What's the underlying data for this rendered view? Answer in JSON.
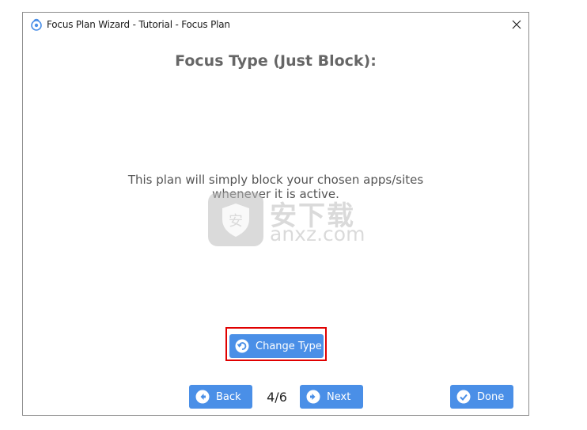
{
  "window": {
    "title": "Focus Plan Wizard - Tutorial - Focus Plan"
  },
  "content": {
    "heading": "Focus Type (Just Block):",
    "description": "This plan will simply block your chosen apps/sites whenever it is active."
  },
  "watermark": {
    "brand": "安下载",
    "domain": "anxz.com"
  },
  "buttons": {
    "change_type": "Change Type",
    "back": "Back",
    "next": "Next",
    "done": "Done"
  },
  "pager": {
    "indicator": "4/6"
  },
  "colors": {
    "button_blue": "#4a8fe7",
    "highlight_red": "#e00000",
    "heading_gray": "#666666"
  },
  "icons": {
    "app": "cold-turkey-icon",
    "close": "close-icon",
    "change": "undo-circle-icon",
    "back": "arrow-left-circle-icon",
    "next": "arrow-right-circle-icon",
    "done": "check-circle-icon"
  }
}
